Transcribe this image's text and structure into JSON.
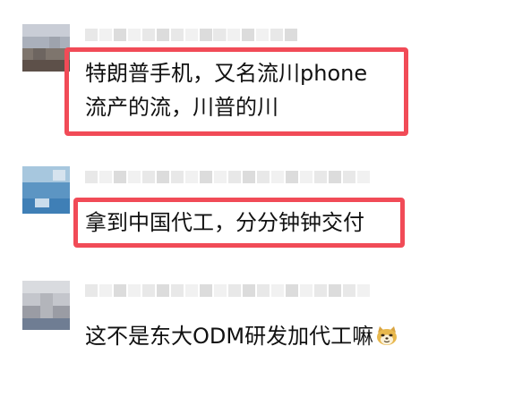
{
  "comments": [
    {
      "lines": [
        "特朗普手机，又名流川phone",
        "流产的流，川普的川"
      ],
      "highlighted": true
    },
    {
      "lines": [
        "拿到中国代工，分分钟钟交付"
      ],
      "highlighted": true
    },
    {
      "lines": [
        "这不是东大ODM研发加代工嘛"
      ],
      "highlighted": false,
      "trailing_emoji": "doge-cat-emoji"
    }
  ],
  "colors": {
    "highlight_border": "#f14b57",
    "text": "#111111"
  }
}
